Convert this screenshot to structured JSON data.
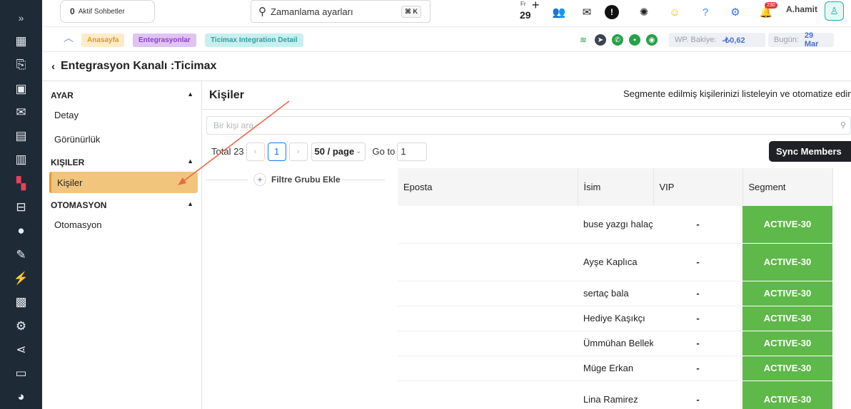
{
  "topbar": {
    "active_chats_count": "0",
    "active_chats_label": "Aktif Sohbetler",
    "search_value": "Zamanlama ayarları",
    "search_shortcut": "⌘ K",
    "date_day": "Fr",
    "date_num": "29",
    "notification_count": "230",
    "username": "A.hamit"
  },
  "breadcrumb": {
    "items": [
      "Anasayfa",
      "Entegrasyonlar",
      "Ticimax Integration Detail"
    ],
    "wp_balance_label": "WP. Bakiye:",
    "wp_balance_value": "-₺0,62",
    "today_label": "Bugün:",
    "today_value": "29 Mar"
  },
  "page": {
    "title": "Entegrasyon Kanalı :Ticimax"
  },
  "leftnav": {
    "sections": [
      {
        "title": "AYAR",
        "items": [
          "Detay",
          "Görünürlük"
        ]
      },
      {
        "title": "KIŞILER",
        "items": [
          "Kişiler"
        ]
      },
      {
        "title": "OTOMASYON",
        "items": [
          "Otomasyon"
        ]
      }
    ]
  },
  "main": {
    "title": "Kişiler",
    "description": "Segmente edilmiş kişilerinizi listeleyin ve otomatize edin",
    "search_placeholder": "Bir kişi ara...",
    "total": "Total 23",
    "current_page": "1",
    "page_size": "50 / page",
    "goto_label": "Go to",
    "goto_value": "1",
    "sync_button": "Sync Members",
    "filter_label": "Filtre Grubu Ekle"
  },
  "table": {
    "columns": [
      "Eposta",
      "İsim",
      "VIP",
      "Segment"
    ],
    "rows": [
      {
        "email": "",
        "name": "buse yazgı halaç",
        "vip": "-",
        "segment": "ACTIVE-30"
      },
      {
        "email": "",
        "name": "Ayşe Kaplıca",
        "vip": "-",
        "segment": "ACTIVE-30"
      },
      {
        "email": "",
        "name": "sertaç bala",
        "vip": "-",
        "segment": "ACTIVE-30"
      },
      {
        "email": "",
        "name": "Hediye Kaşıkçı",
        "vip": "-",
        "segment": "ACTIVE-30"
      },
      {
        "email": "",
        "name": "Ümmühan Bellek",
        "vip": "-",
        "segment": "ACTIVE-30"
      },
      {
        "email": "",
        "name": "Müge Erkan",
        "vip": "-",
        "segment": "ACTIVE-30"
      },
      {
        "email": "",
        "name": "Lina Ramirez",
        "vip": "-",
        "segment": "ACTIVE-30"
      }
    ]
  },
  "colors": {
    "rail": "#1f2a37",
    "active_nav": "#f2c57c",
    "segment_green": "#5fb84a",
    "arrow": "#e86a4a"
  }
}
